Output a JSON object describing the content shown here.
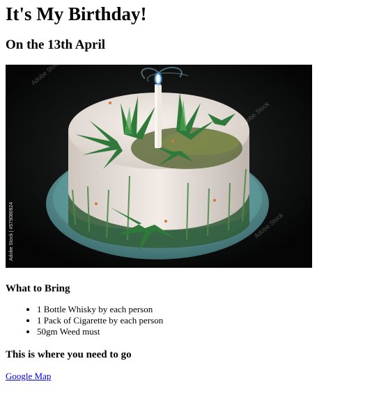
{
  "page": {
    "title": "It's My Birthday!",
    "date_heading": "On the 13th April",
    "image": {
      "watermark": "Adobe Stock",
      "stock_id": "Adobe Stock | #579080924",
      "accent_colors": [
        "#0b0b0b",
        "#f3ece6",
        "#2f7a3a",
        "#6fb7b5",
        "#cfe6ff"
      ]
    },
    "bring_heading": "What to Bring",
    "bring_items": [
      "1 Bottle Whisky by each person",
      "1 Pack of Cigarette by each person",
      "50gm Weed must"
    ],
    "location_heading": "This is where you need to go",
    "map_link_label": "Google Map",
    "link_color": "#0000ee"
  }
}
